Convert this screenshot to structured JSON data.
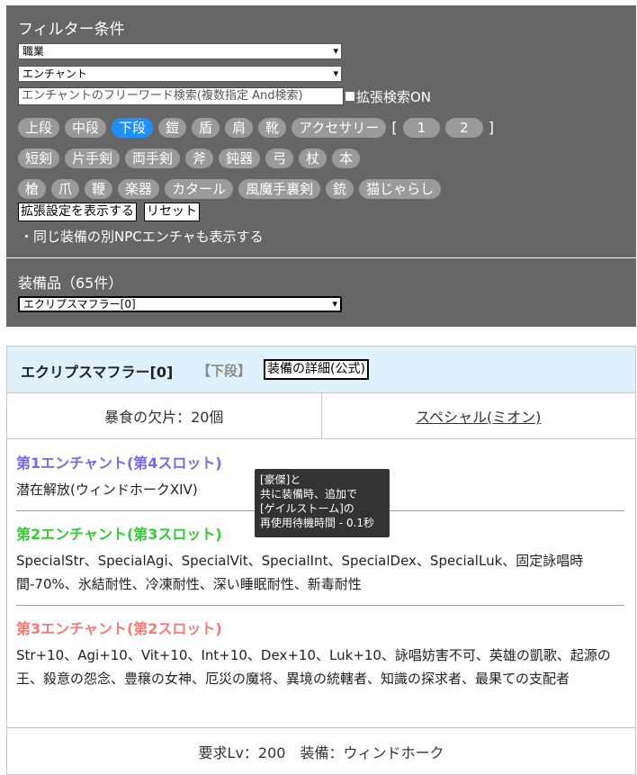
{
  "filter": {
    "title": "フィルター条件",
    "select1": "職業",
    "select2": "エンチャント",
    "search_placeholder": "エンチャントのフリーワード検索(複数指定 And検索)",
    "ext_search_label": "拡張検索ON",
    "row1": [
      "上段",
      "中段",
      "下段",
      "鎧",
      "盾",
      "肩",
      "靴",
      "アクセサリー"
    ],
    "row1_active": "下段",
    "bracket_open": "[",
    "bracket_close": "]",
    "acc_pages": [
      "1",
      "2"
    ],
    "row2": [
      "短剣",
      "片手剣",
      "両手剣",
      "斧",
      "鈍器",
      "弓",
      "杖",
      "本"
    ],
    "row3": [
      "槍",
      "爪",
      "鞭",
      "楽器",
      "カタール",
      "風魔手裏剣",
      "銃",
      "猫じゃらし"
    ],
    "show_ext_button": "拡張設定を表示する",
    "reset_button": "リセット",
    "show_npc_text": "・同じ装備の別NPCエンチャも表示する"
  },
  "equip": {
    "label": "装備品（65件）",
    "selected": "エクリプスマフラー[0]"
  },
  "card": {
    "item_name": "エクリプスマフラー[0]",
    "slot_tag": "【下段】",
    "detail_button": "装備の詳細(公式)",
    "material": "暴食の欠片：20個",
    "npc_link": "スペシャル(ミオン)",
    "enchants": [
      {
        "title": "第1エンチャント(第4スロット)",
        "body": "潜在解放(ウィンドホークXIV)"
      },
      {
        "title": "第2エンチャント(第3スロット)",
        "body": "SpecialStr、SpecialAgi、SpecialVit、SpecialInt、SpecialDex、SpecialLuk、固定詠唱時間-70%、氷結耐性、冷凍耐性、深い睡眠耐性、新毒耐性"
      },
      {
        "title": "第3エンチャント(第2スロット)",
        "body": "Str+10、Agi+10、Vit+10、Int+10、Dex+10、Luk+10、詠唱妨害不可、英雄の凱歌、起源の王、殺意の怨念、豊穣の女神、厄災の魔将、異境の統轄者、知識の探求者、最果ての支配者"
      }
    ],
    "tooltip_lines": [
      "[豪傑]と",
      "共に装備時、追加で",
      "[ゲイルストーム]の",
      "再使用待機時間 - 0.1秒"
    ],
    "footer": "要求Lv：200　装備：ウィンドホーク"
  }
}
